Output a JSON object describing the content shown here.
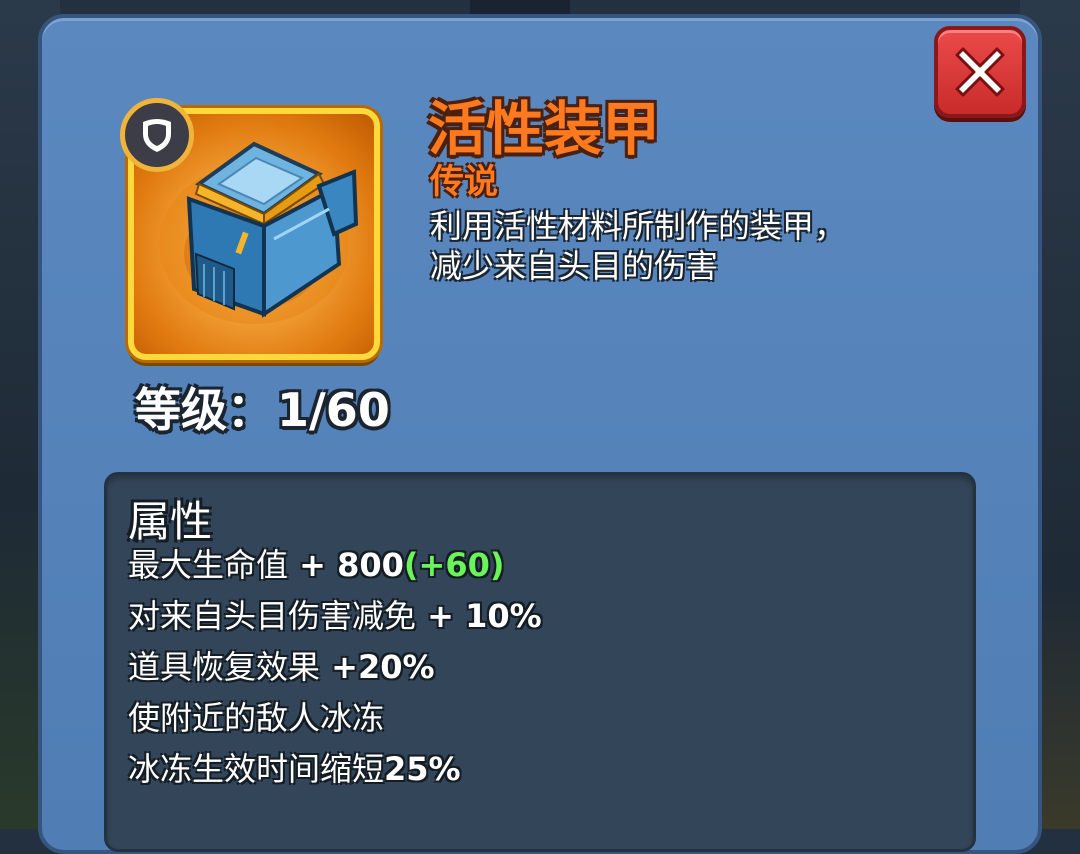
{
  "item": {
    "name": "活性装甲",
    "rarity": "传说",
    "description_lines": [
      "利用活性材料所制作的装甲，",
      "减少来自头目的伤害"
    ]
  },
  "level": {
    "label": "等级：",
    "value": "1/60"
  },
  "attributes": {
    "title": "属性",
    "lines": [
      {
        "label": "最大生命值",
        "value": " + 800",
        "bonus": "(+60)"
      },
      {
        "label": "对来自头目伤害减免",
        "value": " + 10%",
        "bonus": ""
      },
      {
        "label": "道具恢复效果",
        "value": " +20%",
        "bonus": ""
      },
      {
        "label": "使附近的敌人冰冻",
        "value": "",
        "bonus": ""
      },
      {
        "label": "冰冻生效时间缩短",
        "value": "25%",
        "bonus": ""
      }
    ]
  },
  "icons": {
    "close": "close-icon",
    "shield": "shield-icon",
    "armor": "armor-item-icon"
  },
  "colors": {
    "panel": "#5a88bf",
    "rarity_orange": "#ff7a1e",
    "bonus_green": "#6bf35a",
    "close_red": "#d93636",
    "frame_gold": "#ffd83a"
  }
}
